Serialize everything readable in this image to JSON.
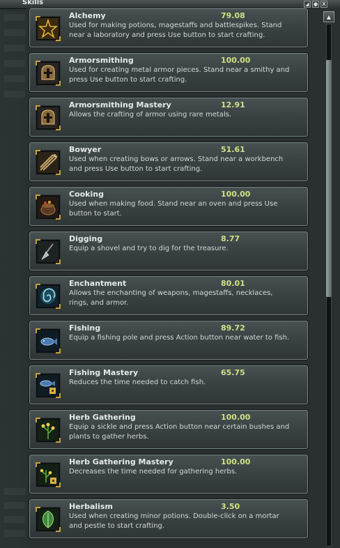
{
  "window": {
    "title": "Skills"
  },
  "controls": {
    "minimize": "◢",
    "restore": "●",
    "close": "X",
    "scroll_up": "▲"
  },
  "skills": [
    {
      "name": "Alchemy",
      "value": "79.08",
      "description": "Used for making potions, magestaffs and battlespikes. Stand near a laboratory and press Use button to start crafting.",
      "icon": "pentagram-icon"
    },
    {
      "name": "Armorsmithing",
      "value": "100.00",
      "description": "Used for creating metal armor pieces. Stand near a smithy and press Use button to start crafting.",
      "icon": "helmet-icon"
    },
    {
      "name": "Armorsmithing Mastery",
      "value": "12.91",
      "description": "Allows the crafting of armor using rare metals.",
      "icon": "helmet-icon"
    },
    {
      "name": "Bowyer",
      "value": "51.61",
      "description": "Used when creating bows or arrows. Stand near a workbench and press Use button to start crafting.",
      "icon": "arrows-icon"
    },
    {
      "name": "Cooking",
      "value": "100.00",
      "description": "Used when making food. Stand near an oven and press Use button to start.",
      "icon": "cooking-pot-icon"
    },
    {
      "name": "Digging",
      "value": "8.77",
      "description": "Equip a shovel and try to dig for the treasure.",
      "icon": "shovel-icon"
    },
    {
      "name": "Enchantment",
      "value": "80.01",
      "description": "Allows the enchanting of weapons, magestaffs, necklaces, rings, and armor.",
      "icon": "swirl-icon"
    },
    {
      "name": "Fishing",
      "value": "89.72",
      "description": "Equip a fishing pole and press Action button near water to fish.",
      "icon": "fish-icon"
    },
    {
      "name": "Fishing Mastery",
      "value": "65.75",
      "description": "Reduces the time needed to catch fish.",
      "icon": "fish-mastery-icon"
    },
    {
      "name": "Herb Gathering",
      "value": "100.00",
      "description": "Equip a sickle and press Action button near certain bushes and plants to gather herbs.",
      "icon": "herb-icon"
    },
    {
      "name": "Herb Gathering Mastery",
      "value": "100.00",
      "description": "Decreases the time needed for gathering herbs.",
      "icon": "herb-mastery-icon"
    },
    {
      "name": "Herbalism",
      "value": "3.50",
      "description": "Used when creating minor potions. Double-click on a mortar and pestle to start crafting.",
      "icon": "leaf-icon"
    }
  ]
}
